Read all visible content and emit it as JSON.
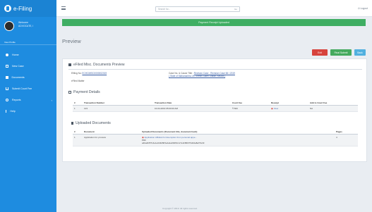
{
  "app": {
    "logo_text": "e-Filing"
  },
  "sidebar": {
    "welcome": "Welcome",
    "user_name": "ADVOCATE, I",
    "view_profile": "View Profile",
    "items": [
      {
        "label": "Home",
        "icon": "home-icon"
      },
      {
        "label": "New Case",
        "icon": "new-case-icon"
      },
      {
        "label": "Documents",
        "icon": "documents-icon"
      },
      {
        "label": "Submit Court Fee",
        "icon": "court-fee-icon"
      },
      {
        "label": "Reports",
        "icon": "reports-icon",
        "has_chevron": true
      },
      {
        "label": "Help",
        "icon": "help-icon"
      }
    ]
  },
  "topbar": {
    "search_placeholder": "Search for...",
    "search_go": "Go",
    "logout": "Logout"
  },
  "banner": {
    "text": "Payment Receipt Uploaded"
  },
  "page": {
    "title": "Preview"
  },
  "actions": {
    "exit": "Exit",
    "final_submit": "Final Submit",
    "back": "Back"
  },
  "card": {
    "header": "eFiled Misc. Documents Preview",
    "efiling_no_label": "Efiling No:",
    "efiling_no": "ECHCMISC0000002019",
    "case_no_label": "Case No. & Cause Title :",
    "case_no": "Revision Case - Revision Case 66 / 2019",
    "cause_title": "( State of Maharashtra Vs. Sheikh Salim Shaikh Rasool )",
    "efiled_by": "eFiled Matter",
    "payment_title": "Payment Details",
    "payment_cols": [
      "#",
      "Transaction Number",
      "Transaction Date",
      "Court Fee",
      "Receipt",
      "Add to Court Fee"
    ],
    "payment_rows": [
      {
        "no": "1",
        "txn": "123",
        "date": "10-04-2019 05:00:00 AM",
        "fee": "₹ 500",
        "receipt": "View",
        "add": "NA"
      }
    ],
    "uploaded_title": "Uploaded Documents",
    "doc_cols": [
      "#",
      "Document",
      "Uploaded Documents (Document title, document hash)",
      "Pages"
    ],
    "doc_rows": [
      {
        "no": "1",
        "doc": "Application for..process",
        "file": "Application Affidavit for Exemption from personal appe...",
        "pdf": "PDF",
        "hash": "a4ba4b5f7c4e1e0d9c8b5e4a1a0b6f9c1c7e3c86bf73d44a8ef7fe33",
        "pages": "4"
      }
    ]
  },
  "footer": "Copyright © 2019. All rights reserved."
}
